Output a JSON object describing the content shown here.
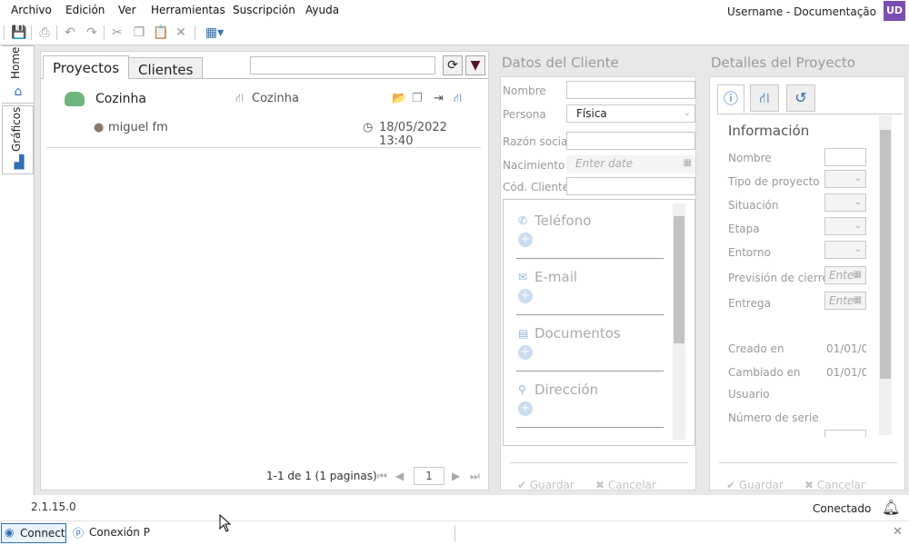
{
  "menu": {
    "items": [
      "Archivo",
      "Edición",
      "Ver",
      "Herramientas",
      "Suscripción",
      "Ayuda"
    ],
    "user_label": "Username - Documentação",
    "user_initials": "UD",
    "avatar_color": "#7a4fb3"
  },
  "sidebar_tabs": {
    "home": "Home",
    "charts": "Gráficos"
  },
  "projects_panel": {
    "tabs": [
      "Proyectos",
      "Clientes"
    ],
    "search_placeholder": "",
    "item": {
      "name": "Cozinha",
      "type_label": "Cozinha",
      "user": "miguel fm",
      "datetime": "18/05/2022 13:40"
    },
    "pager": {
      "summary": "1-1 de 1 (1 paginas)",
      "page": "1"
    }
  },
  "client_panel": {
    "title": "Datos del Cliente",
    "fields": {
      "nombre_label": "Nombre",
      "nombre_value": "",
      "persona_label": "Persona",
      "persona_value": "Física",
      "razon_label": "Razón social",
      "razon_value": "",
      "nacimiento_label": "Nacimiento",
      "nacimiento_placeholder": "Enter date",
      "cod_label": "Cód. Cliente",
      "cod_value": ""
    },
    "sections": [
      "Teléfono",
      "E-mail",
      "Documentos",
      "Dirección"
    ],
    "save_label": "Guardar",
    "cancel_label": "Cancelar"
  },
  "project_panel": {
    "title": "Detalles del Proyecto",
    "info_title": "Información",
    "labels": {
      "nombre": "Nombre",
      "tipo": "Tipo de proyecto",
      "situacion": "Situación",
      "etapa": "Etapa",
      "entorno": "Entorno",
      "prevision": "Previsión de cierre",
      "entrega": "Entrega",
      "creado": "Creado en",
      "cambiado": "Cambiado en",
      "usuario": "Usuario",
      "numero": "Número de serie"
    },
    "date_placeholder": "Ente",
    "creado_value": "01/01/0(",
    "cambiado_value": "01/01/0(",
    "save_label": "Guardar",
    "cancel_label": "Cancelar"
  },
  "status": {
    "version": "2.1.15.0",
    "connection": "Conectado"
  },
  "taskbar": {
    "connect_label": "Connect",
    "conexion_label": "Conexión P"
  },
  "colors": {
    "accent_blue": "#2f6fb3",
    "cloud_green": "#6fb57e",
    "folder_orange": "#e8a44a",
    "filter_dark": "#5a1030"
  }
}
